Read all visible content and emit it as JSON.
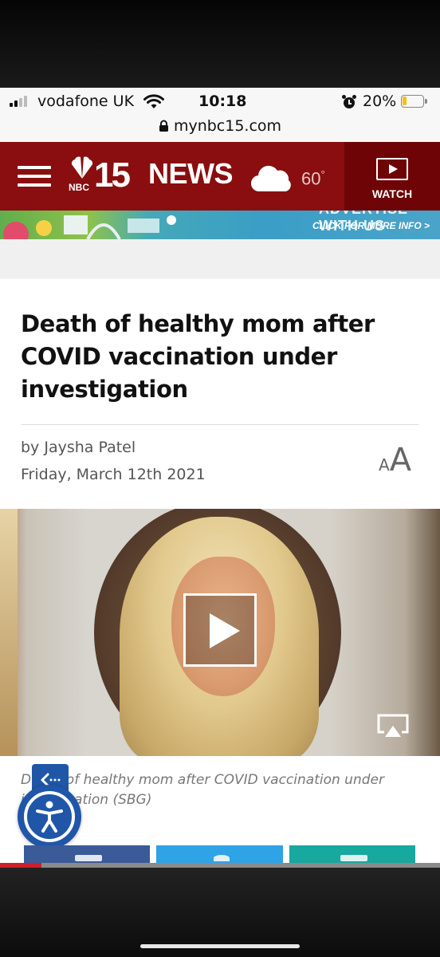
{
  "status_bar": {
    "carrier": "vodafone UK",
    "time": "10:18",
    "battery_percent": "20%",
    "battery_level": 0.2
  },
  "browser": {
    "url": "mynbc15.com"
  },
  "header": {
    "logo_nbc": "NBC",
    "logo_number": "15",
    "logo_news": "NEWS",
    "temperature": "60",
    "temperature_unit": "°",
    "watch_label": "WATCH",
    "brand_color": "#8a0e0f"
  },
  "ad": {
    "headline": "ADVERTISE WITH US",
    "cta": "CLICK FOR MORE INFO >"
  },
  "article": {
    "headline": "Death of healthy mom after COVID vaccination under investigation",
    "byline": "by Jaysha Patel",
    "date": "Friday, March 12th 2021",
    "text_size_small": "A",
    "text_size_large": "A"
  },
  "video": {
    "caption": "Death of healthy mom after COVID vaccination under investigation (SBG)"
  },
  "share": {
    "facebook_color": "#3a5a98",
    "twitter_color": "#2ea3e6",
    "email_color": "#17a89f"
  },
  "icons": [
    "signal-icon",
    "wifi-icon",
    "alarm-icon",
    "battery-icon",
    "lock-icon",
    "hamburger-icon",
    "peacock-icon",
    "cloud-icon",
    "watch-icon",
    "play-icon",
    "airplay-icon",
    "accessibility-icon",
    "collapse-arrow-icon"
  ]
}
